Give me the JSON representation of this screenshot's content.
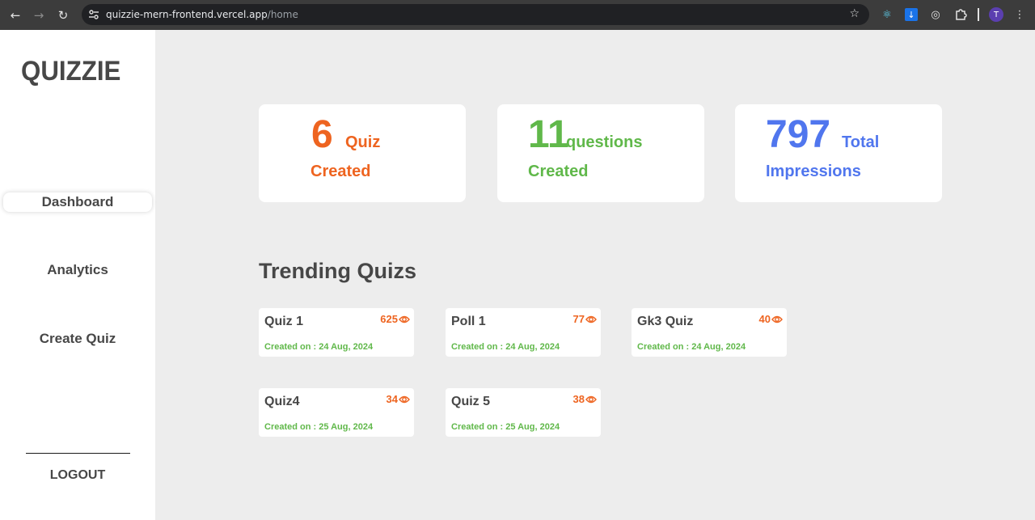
{
  "browser": {
    "url_host": "quizzie-mern-frontend.vercel.app",
    "url_path": "/home",
    "avatar_initial": "T"
  },
  "colors": {
    "orange": "#ee6420",
    "green": "#60b84a",
    "blue": "#5076ee",
    "text_dark": "#474747",
    "background": "#ededed"
  },
  "sidebar": {
    "logo": "QUIZZIE",
    "items": [
      {
        "label": "Dashboard",
        "active": true
      },
      {
        "label": "Analytics",
        "active": false
      },
      {
        "label": "Create Quiz",
        "active": false
      }
    ],
    "logout": "LOGOUT"
  },
  "stats": [
    {
      "number": "6",
      "unit": "Quiz",
      "sub": "Created",
      "color": "#ee6420"
    },
    {
      "number": "11",
      "unit": "questions",
      "sub": "Created",
      "color": "#60b84a"
    },
    {
      "number": "797",
      "unit": "Total",
      "sub": "Impressions",
      "color": "#5076ee"
    }
  ],
  "trending": {
    "title": "Trending Quizs",
    "quizzes": [
      {
        "name": "Quiz 1",
        "views": "625",
        "created": "Created on : 24 Aug, 2024"
      },
      {
        "name": "Poll 1",
        "views": "77",
        "created": "Created on : 24 Aug, 2024"
      },
      {
        "name": "Gk3 Quiz",
        "views": "40",
        "created": "Created on : 24 Aug, 2024"
      },
      {
        "name": "Quiz4",
        "views": "34",
        "created": "Created on : 25 Aug, 2024"
      },
      {
        "name": "Quiz 5",
        "views": "38",
        "created": "Created on : 25 Aug, 2024"
      }
    ]
  }
}
